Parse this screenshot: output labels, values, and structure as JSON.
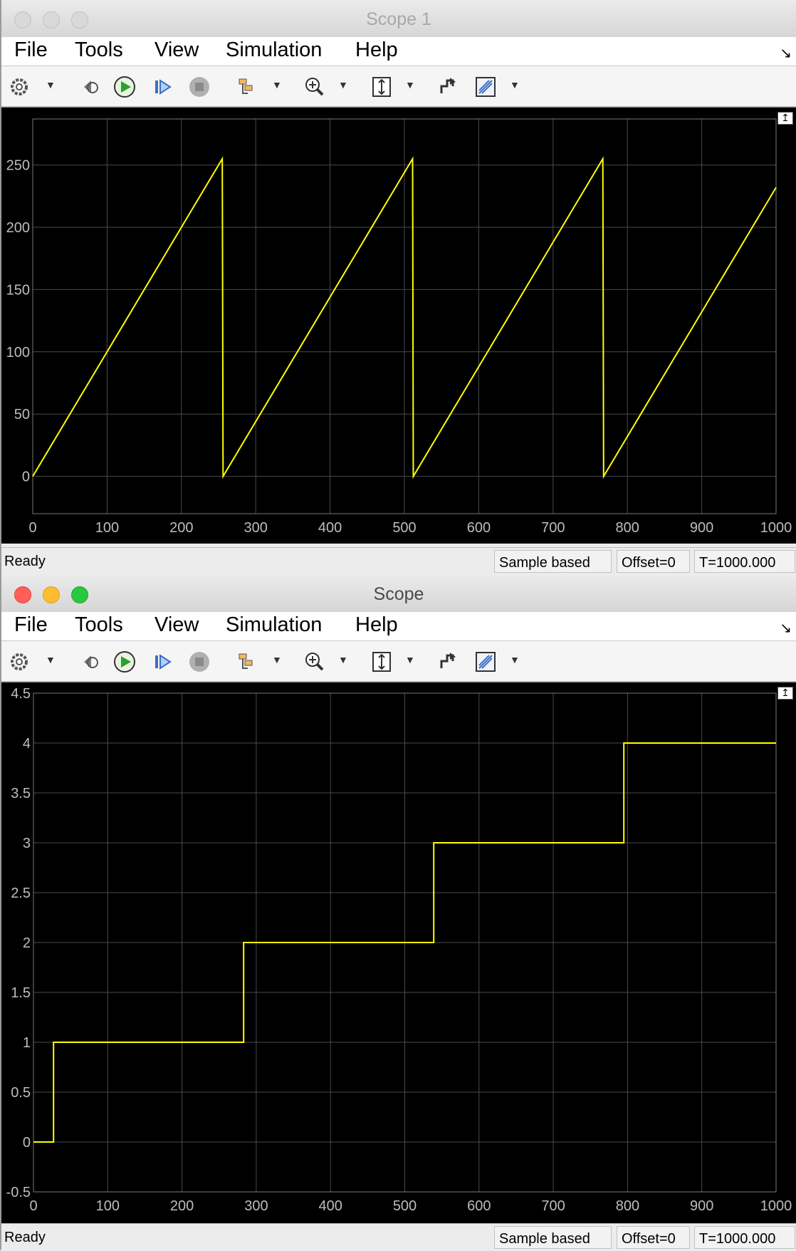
{
  "windows": [
    {
      "title": "Scope 1",
      "active": false,
      "menu": [
        "File",
        "Tools",
        "View",
        "Simulation",
        "Help"
      ],
      "status": {
        "ready": "Ready",
        "mode": "Sample based",
        "offset": "Offset=0",
        "time": "T=1000.000"
      }
    },
    {
      "title": "Scope",
      "active": true,
      "menu": [
        "File",
        "Tools",
        "View",
        "Simulation",
        "Help"
      ],
      "status": {
        "ready": "Ready",
        "mode": "Sample based",
        "offset": "Offset=0",
        "time": "T=1000.000"
      }
    }
  ],
  "toolbar_icons": [
    "settings-icon",
    "step-back-icon",
    "run-icon",
    "step-forward-icon",
    "stop-icon",
    "highlight-icon",
    "zoom-in-icon",
    "scale-axes-icon",
    "restore-icon",
    "measurements-icon"
  ],
  "colors": {
    "trace": "#ffff00",
    "plot_bg": "#000000",
    "grid": "#4a4a4a",
    "tick_text": "#bdbdbd"
  },
  "chart_data": [
    {
      "type": "line",
      "title": "",
      "xlabel": "",
      "ylabel": "",
      "xlim": [
        0,
        1000
      ],
      "ylim": [
        -30,
        287
      ],
      "xticks": [
        0,
        100,
        200,
        300,
        400,
        500,
        600,
        700,
        800,
        900,
        1000
      ],
      "yticks": [
        0,
        50,
        100,
        150,
        200,
        250
      ],
      "grid": true,
      "series": [
        {
          "x": [
            0,
            255,
            256,
            511,
            512,
            767,
            768,
            1000
          ],
          "y": [
            0,
            255,
            0,
            255,
            0,
            255,
            0,
            232
          ]
        }
      ]
    },
    {
      "type": "line",
      "title": "",
      "xlabel": "",
      "ylabel": "",
      "xlim": [
        0,
        1000
      ],
      "ylim": [
        -0.5,
        4.5
      ],
      "xticks": [
        0,
        100,
        200,
        300,
        400,
        500,
        600,
        700,
        800,
        900,
        1000
      ],
      "yticks": [
        -0.5,
        0,
        0.5,
        1,
        1.5,
        2,
        2.5,
        3,
        3.5,
        4,
        4.5
      ],
      "ytick_labels": [
        "-0.5",
        "0",
        "0.5",
        "1",
        "1.5",
        "2",
        "2.5",
        "3",
        "3.5",
        "4",
        "4.5"
      ],
      "grid": true,
      "series": [
        {
          "x": [
            0,
            27,
            27,
            283,
            283,
            539,
            539,
            795,
            795,
            1000
          ],
          "y": [
            0,
            0,
            1,
            1,
            2,
            2,
            3,
            3,
            4,
            4
          ]
        }
      ]
    }
  ]
}
